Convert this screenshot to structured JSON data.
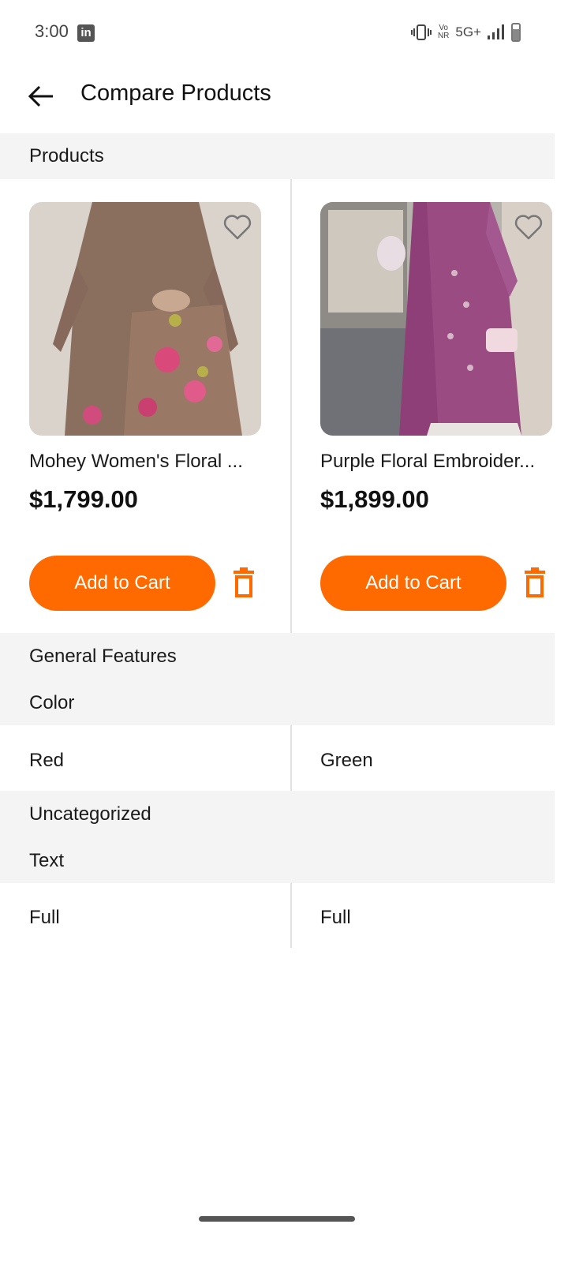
{
  "status_bar": {
    "time": "3:00",
    "app_icon_letters": "in",
    "network": "5G+",
    "vonr_top": "Vo",
    "vonr_bottom": "NR"
  },
  "header": {
    "title": "Compare Products",
    "back_icon": "arrow-left-icon"
  },
  "sections": {
    "products_label": "Products",
    "general_features_label": "General Features",
    "color_label": "Color",
    "uncategorized_label": "Uncategorized",
    "text_label": "Text"
  },
  "products": [
    {
      "name": "Mohey Women's Floral ...",
      "price": "$1,799.00",
      "add_to_cart_label": "Add to Cart",
      "color": "Red",
      "text": "Full"
    },
    {
      "name": "Purple Floral Embroider...",
      "price": "$1,899.00",
      "add_to_cart_label": "Add to Cart",
      "color": "Green",
      "text": "Full"
    }
  ],
  "colors": {
    "accent": "#ff6a00",
    "section_bg": "#f4f4f4",
    "divider": "#e2e2e2"
  }
}
